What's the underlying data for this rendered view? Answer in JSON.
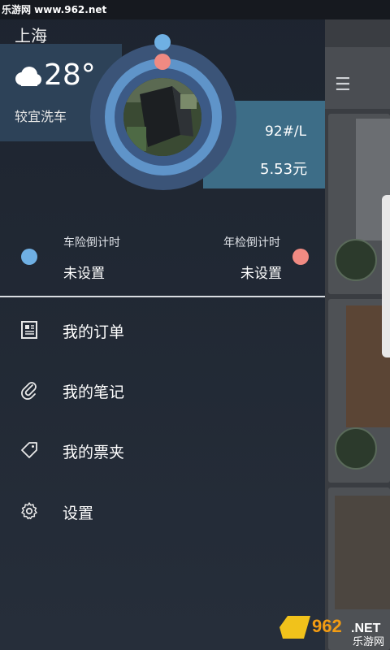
{
  "statusbar": {
    "watermark": "乐游网 www.962.net"
  },
  "header": {
    "city": "上海",
    "weather_icon": "cloud-icon",
    "temperature": "28°",
    "car_wash_tip": "较宜洗车",
    "fuel_type": "92#/L",
    "fuel_price": "5.53元"
  },
  "countdowns": {
    "insurance": {
      "label": "车险倒计时",
      "value": "未设置",
      "color": "#6fb0e4"
    },
    "inspection": {
      "label": "年检倒计时",
      "value": "未设置",
      "color": "#f08a82"
    }
  },
  "menu": {
    "items": [
      {
        "label": "我的订单",
        "icon": "receipt-icon"
      },
      {
        "label": "我的笔记",
        "icon": "paperclip-icon"
      },
      {
        "label": "我的票夹",
        "icon": "tag-icon"
      },
      {
        "label": "设置",
        "icon": "gear-icon"
      }
    ]
  },
  "background_app": {
    "menu_icon": "☰"
  },
  "colors": {
    "accent_blue": "#6fb0e4",
    "accent_red": "#f08a82",
    "band_blue": "#3d6d87"
  }
}
